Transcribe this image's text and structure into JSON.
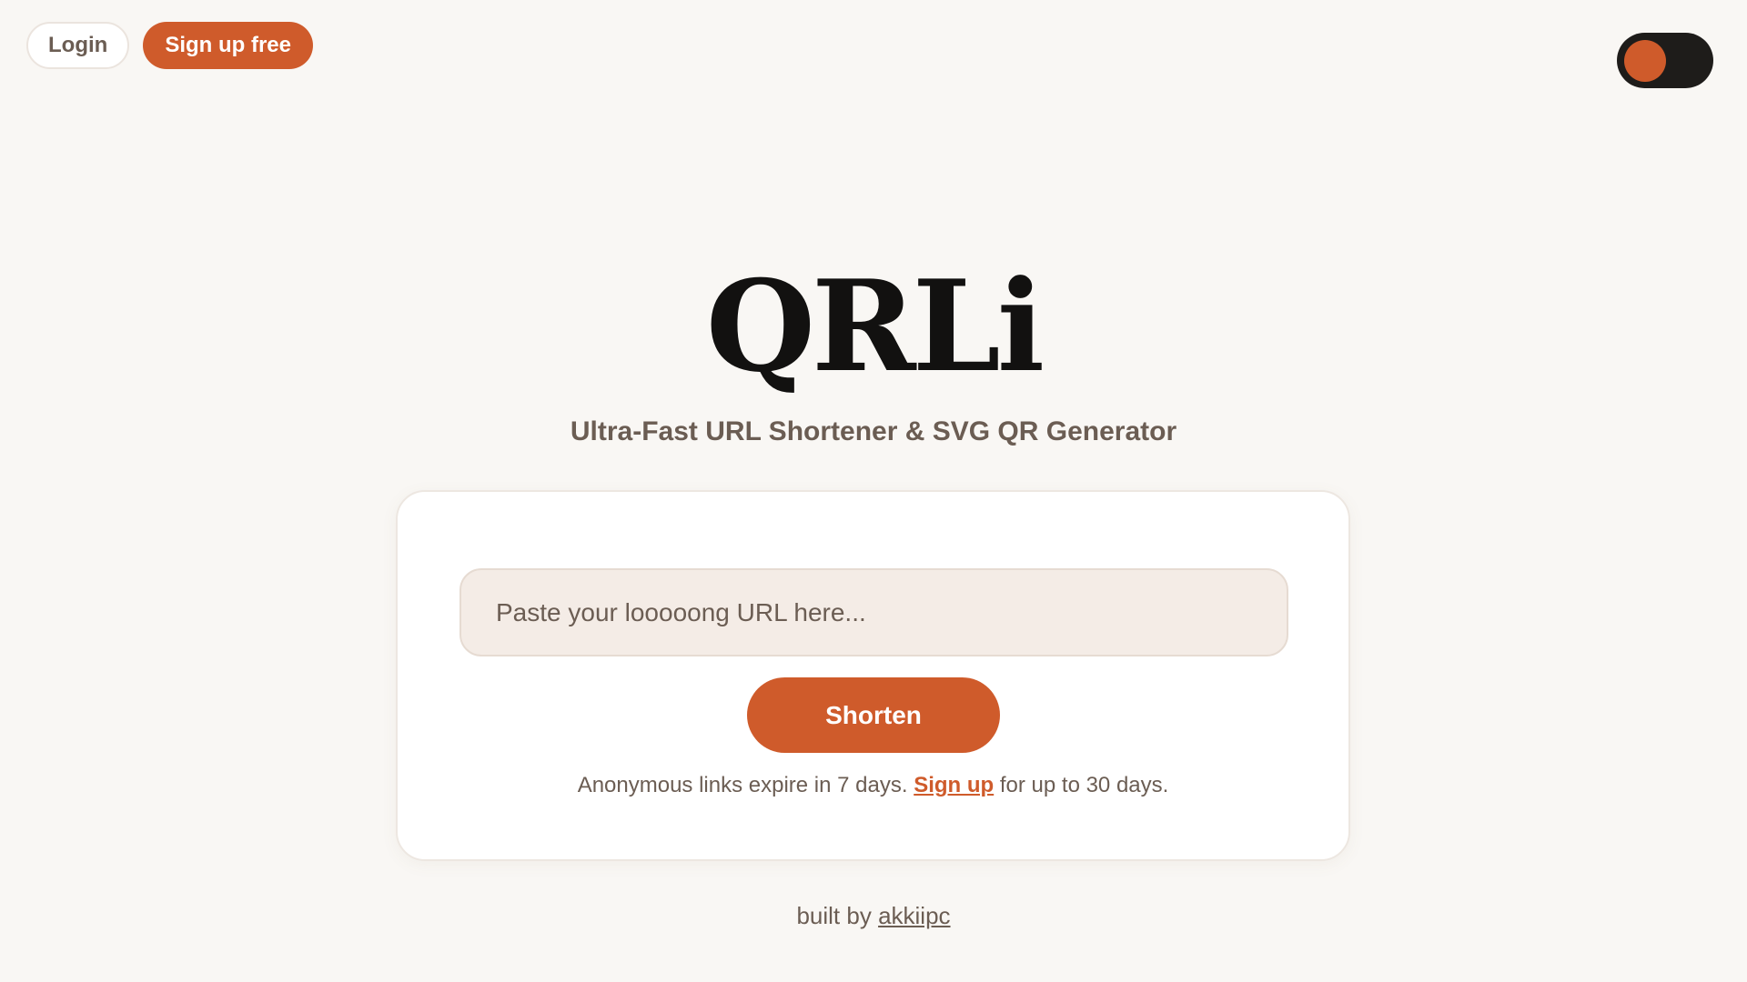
{
  "header": {
    "login_label": "Login",
    "signup_label": "Sign up free"
  },
  "theme_toggle": {
    "icon": "theme-toggle-icon"
  },
  "hero": {
    "logo": "QRLi",
    "subtitle": "Ultra-Fast URL Shortener & SVG QR Generator"
  },
  "form": {
    "url_placeholder": "Paste your looooong URL here...",
    "url_value": "",
    "shorten_label": "Shorten",
    "note_prefix": "Anonymous links expire in 7 days. ",
    "note_link": "Sign up",
    "note_suffix": " for up to 30 days."
  },
  "footer": {
    "prefix": "built by ",
    "author": "akkiipc"
  },
  "colors": {
    "accent": "#cf5b2b",
    "background": "#f9f7f4",
    "text": "#6b5d53",
    "toggle_track": "#1e1c1a"
  }
}
